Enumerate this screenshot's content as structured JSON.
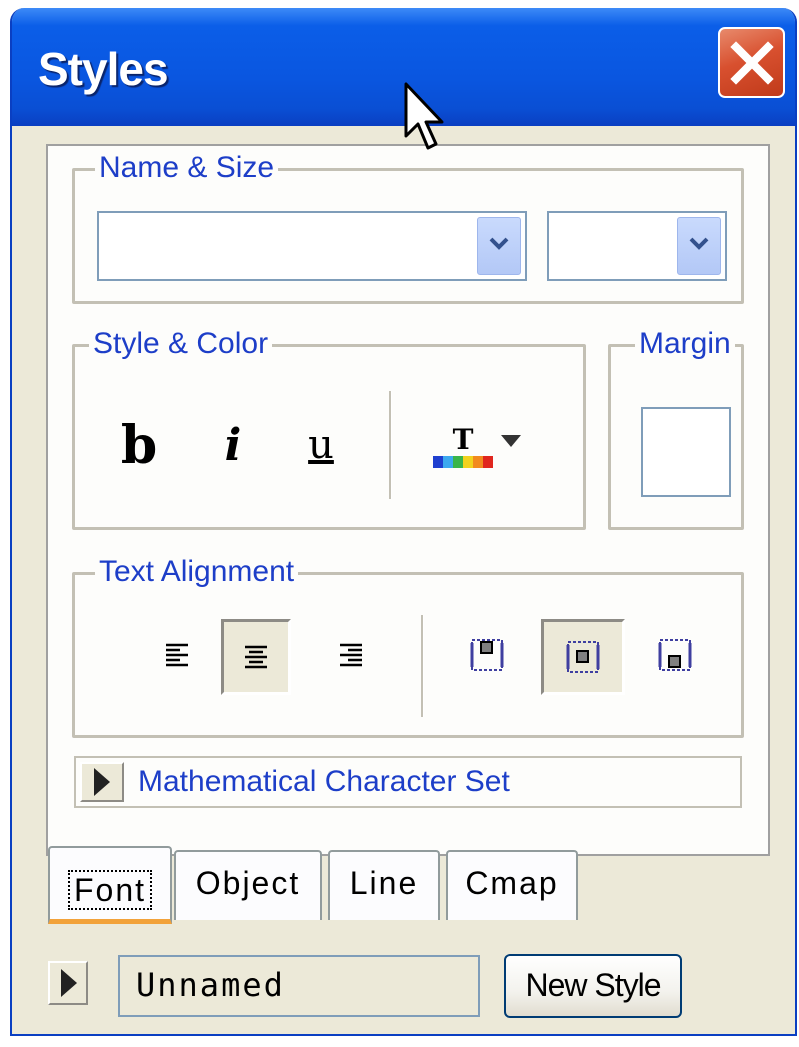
{
  "window": {
    "title": "Styles",
    "close_icon": "close-x-icon"
  },
  "name_size": {
    "legend": "Name & Size",
    "font_name_value": "",
    "font_size_value": ""
  },
  "style_color": {
    "legend": "Style & Color",
    "bold_label": "b",
    "italic_label": "i",
    "underline_label": "u",
    "color_label": "T"
  },
  "margin": {
    "legend": "Margin"
  },
  "alignment": {
    "legend": "Text Alignment"
  },
  "math": {
    "label": "Mathematical Character Set"
  },
  "tabs": [
    {
      "label": "Font",
      "active": true
    },
    {
      "label": "Object",
      "active": false
    },
    {
      "label": "Line",
      "active": false
    },
    {
      "label": "Cmap",
      "active": false
    }
  ],
  "bottom": {
    "style_name": "Unnamed",
    "new_style_label": "New Style"
  },
  "colors": {
    "titlebar": "#0a56e0",
    "legend_text": "#1d3ec8",
    "active_tab_accent": "#f2a23a",
    "close_button": "#d8502f"
  }
}
